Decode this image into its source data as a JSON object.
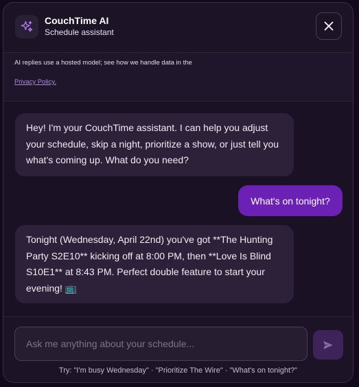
{
  "header": {
    "icon": "sparkles-icon",
    "title": "CouchTime AI",
    "subtitle": "Schedule assistant",
    "close_icon": "close-icon"
  },
  "notice": {
    "text": "AI replies use a hosted model; see how we handle data in the",
    "link": "Privacy Policy."
  },
  "messages": [
    {
      "role": "assistant",
      "text": "Hey! I'm your CouchTime assistant. I can help you adjust your schedule, skip a night, prioritize a show, or just tell you what's coming up. What do you need?"
    },
    {
      "role": "user",
      "text": "What's on tonight?"
    },
    {
      "role": "assistant",
      "text": "Tonight (Wednesday, April 22nd) you've got **The Hunting Party S2E10** kicking off at 8:00 PM, then **Love Is Blind S10E1** at 8:43 PM. Perfect double feature to start your evening! 📺"
    }
  ],
  "composer": {
    "placeholder": "Ask me anything about your schedule...",
    "value": "",
    "send_icon": "send-icon",
    "hints": "Try: \"I'm busy Wednesday\" · \"Prioritize The Wire\" · \"What's on tonight?\""
  },
  "colors": {
    "accent": "#6b22b4",
    "panel_bg": "#1c1326",
    "bubble_bot": "#2c2138"
  }
}
